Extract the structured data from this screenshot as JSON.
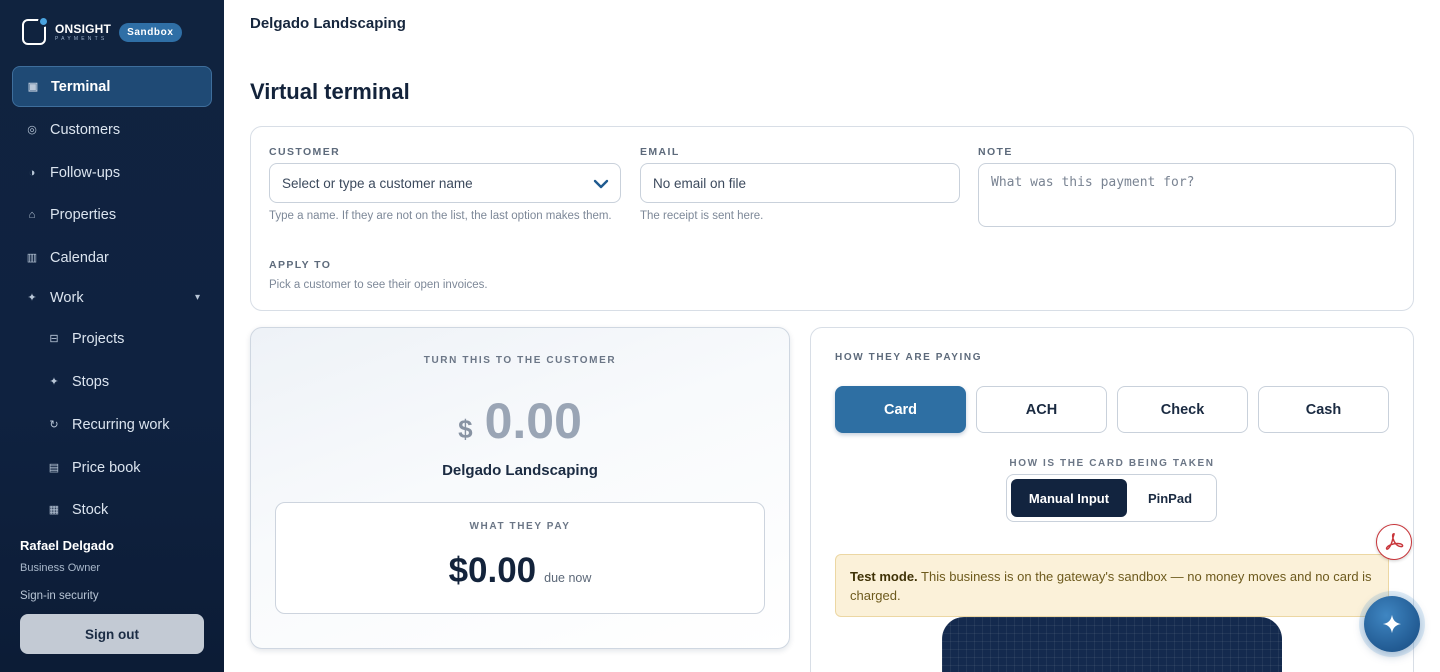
{
  "brand": {
    "name": "ONSIGHT",
    "sub": "PAYMENTS",
    "badge": "Sandbox"
  },
  "nav": {
    "terminal": "Terminal",
    "customers": "Customers",
    "followups": "Follow-ups",
    "properties": "Properties",
    "calendar": "Calendar",
    "work": "Work",
    "projects": "Projects",
    "stops": "Stops",
    "recurring": "Recurring work",
    "pricebook": "Price book",
    "stock": "Stock"
  },
  "user": {
    "name": "Rafael Delgado",
    "role": "Business Owner",
    "security": "Sign-in security",
    "signout": "Sign out"
  },
  "header": {
    "business": "Delgado Landscaping",
    "title": "Virtual terminal"
  },
  "form": {
    "customer_label": "CUSTOMER",
    "customer_placeholder": "Select or type a customer name",
    "customer_help": "Type a name. If they are not on the list, the last option makes them.",
    "email_label": "EMAIL",
    "email_placeholder": "No email on file",
    "email_help": "The receipt is sent here.",
    "note_label": "NOTE",
    "note_placeholder": "What was this payment for?",
    "apply_label": "APPLY TO",
    "apply_help": "Pick a customer to see their open invoices."
  },
  "display": {
    "kicker": "TURN THIS TO THE CUSTOMER",
    "currency": "$",
    "amount": "0.00",
    "business": "Delgado Landscaping",
    "pay_label": "WHAT THEY PAY",
    "pay_amount": "$0.00",
    "due": "due now"
  },
  "payment": {
    "method_label": "HOW THEY ARE PAYING",
    "methods": [
      "Card",
      "ACH",
      "Check",
      "Cash"
    ],
    "selected_method": "Card",
    "entry_label": "HOW IS THE CARD BEING TAKEN",
    "entry_modes": [
      "Manual Input",
      "PinPad"
    ],
    "selected_entry": "Manual Input",
    "test_strong": "Test mode.",
    "test_text": " This business is on the gateway's sandbox — no money moves and no card is charged."
  },
  "colors": {
    "sidebar": "#10233f",
    "accent": "#2e6fa3",
    "dark": "#12243f",
    "warning_bg": "#fbf1d9"
  }
}
